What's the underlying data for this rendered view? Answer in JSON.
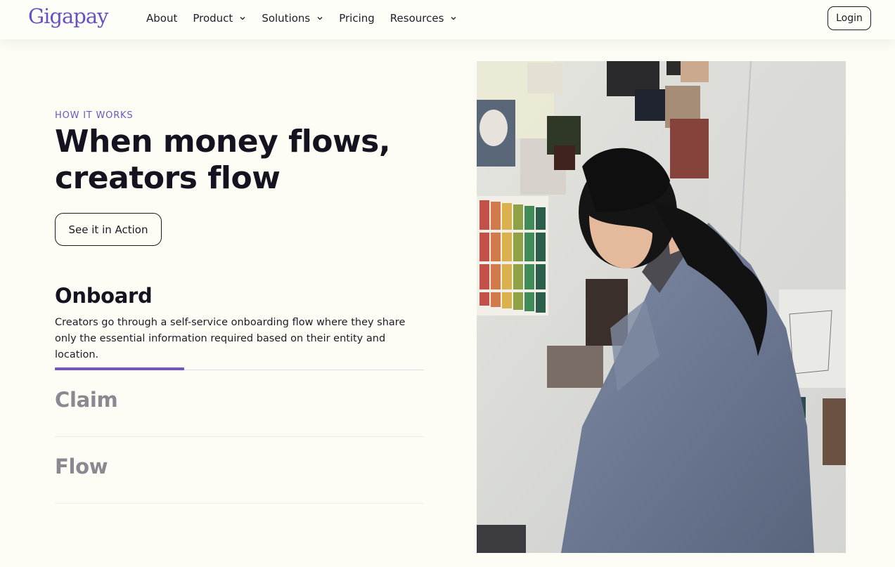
{
  "nav": {
    "logo": "Gigapay",
    "links": [
      {
        "label": "About",
        "has_menu": false
      },
      {
        "label": "Product",
        "has_menu": true
      },
      {
        "label": "Solutions",
        "has_menu": true
      },
      {
        "label": "Pricing",
        "has_menu": false
      },
      {
        "label": "Resources",
        "has_menu": true
      }
    ],
    "login_label": "Login"
  },
  "hero": {
    "eyebrow": "HOW IT WORKS",
    "headline_line1": "When money flows,",
    "headline_line2": "creators flow",
    "cta_label": "See it in Action"
  },
  "steps": {
    "active": {
      "title": "Onboard",
      "description": "Creators go through a self-service onboarding flow where they share only the essential information required based on their entity and location."
    },
    "progress": 0.35,
    "inactive": [
      {
        "title": "Claim"
      },
      {
        "title": "Flow"
      }
    ]
  },
  "colors": {
    "accent": "#7454c6",
    "background": "#fdfdf6",
    "text": "#15131f",
    "muted": "#8a8890"
  },
  "icons": {
    "chevron": "chevron-down-icon"
  }
}
